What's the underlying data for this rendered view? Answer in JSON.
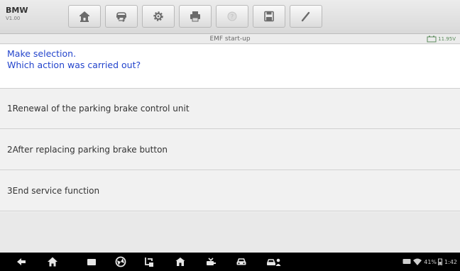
{
  "app": {
    "brand": "BMW",
    "version": "V1.00"
  },
  "toolbar": {
    "buttons": [
      {
        "name": "home",
        "icon": "home-icon"
      },
      {
        "name": "vehicle-swap",
        "icon": "vehicle-swap-icon"
      },
      {
        "name": "settings",
        "icon": "gear-icon"
      },
      {
        "name": "print",
        "icon": "printer-icon"
      },
      {
        "name": "help",
        "icon": "help-icon",
        "disabled": true
      },
      {
        "name": "save",
        "icon": "save-icon"
      },
      {
        "name": "data-logging",
        "icon": "pen-icon"
      }
    ]
  },
  "titlebar": {
    "title": "EMF start-up",
    "voltage": "11.95V"
  },
  "main": {
    "prompt_line1": "Make selection.",
    "prompt_line2": "Which action was carried out?",
    "options": [
      "1Renewal of the parking brake control unit",
      "2After replacing parking brake button",
      "3End service function"
    ]
  },
  "navbar": {
    "icons": [
      "back-icon",
      "home-icon",
      "recent-apps-icon",
      "browser-icon",
      "shortcut-icon",
      "autel-home-icon",
      "vci-icon",
      "car-icon",
      "car-service-icon"
    ],
    "battery": "41%",
    "time": "1:42"
  },
  "colors": {
    "prompt_text": "#2344cc",
    "background": "#f4f4f4"
  }
}
